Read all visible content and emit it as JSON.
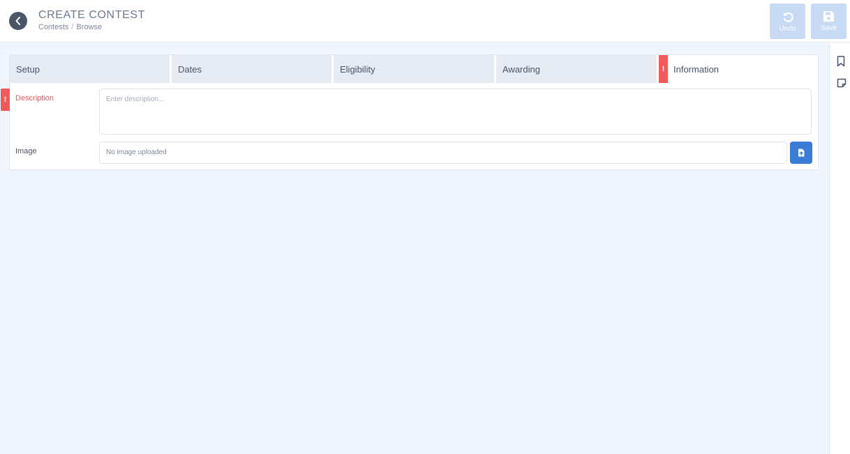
{
  "header": {
    "title": "CREATE CONTEST",
    "breadcrumb": [
      "Contests",
      "Browse"
    ],
    "breadcrumb_sep": "/",
    "undo_label": "Undo",
    "save_label": "Save"
  },
  "tabs": [
    {
      "label": "Setup",
      "active": false,
      "error": false
    },
    {
      "label": "Dates",
      "active": false,
      "error": false
    },
    {
      "label": "Eligibility",
      "active": false,
      "error": false
    },
    {
      "label": "Awarding",
      "active": false,
      "error": false
    },
    {
      "label": "Information",
      "active": true,
      "error": true
    }
  ],
  "error_marker": "!",
  "form": {
    "description": {
      "label": "Description",
      "placeholder": "Enter description...",
      "value": "",
      "error": true
    },
    "image": {
      "label": "Image",
      "value": "No image uploaded"
    }
  },
  "icons": {
    "back": "chevron-left-icon",
    "undo": "undo-icon",
    "save": "floppy-disk-icon",
    "upload": "file-upload-icon",
    "bookmark": "bookmark-icon",
    "note": "sticky-note-icon"
  },
  "colors": {
    "accent": "#3a7bd5",
    "error": "#ef5b5b",
    "disabled_button": "#c9daf4",
    "background": "#f1f5fd"
  }
}
